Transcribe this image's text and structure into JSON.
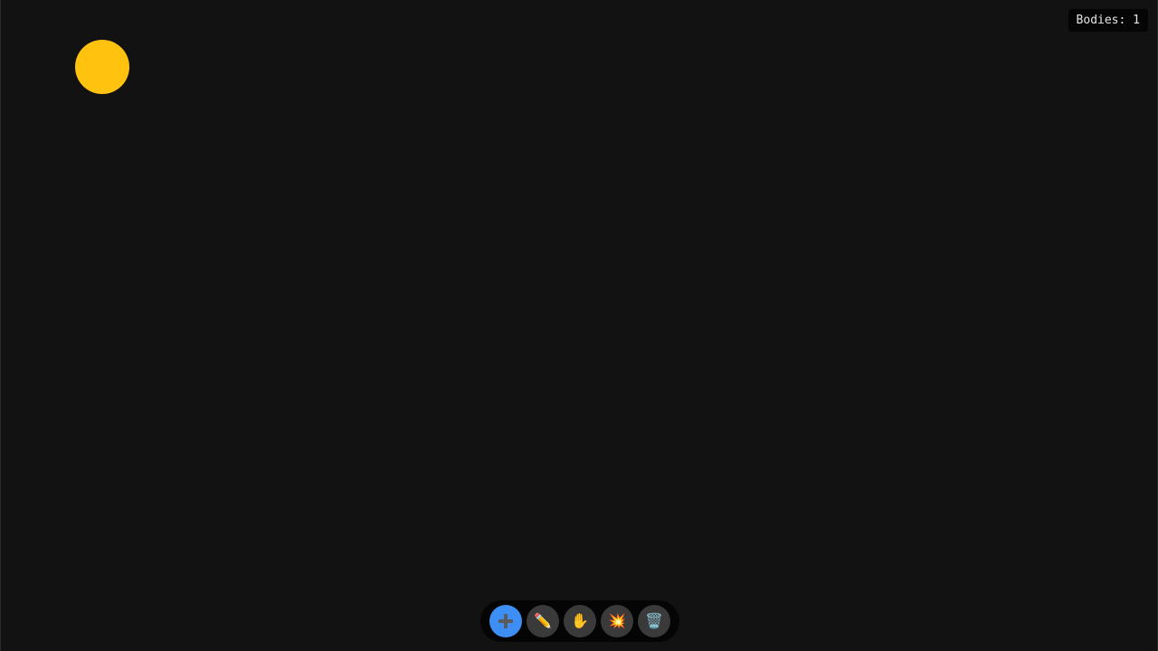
{
  "canvas": {
    "background": "#121212"
  },
  "bodies": [
    {
      "shape": "circle",
      "color": "#ffc20f"
    }
  ],
  "status": {
    "bodies_label": "Bodies: 1"
  },
  "toolbar": {
    "active_tool": "add",
    "active_color": "#3d8ef5",
    "tools": [
      {
        "name": "add",
        "icon": "plus-icon"
      },
      {
        "name": "draw",
        "icon": "pencil-icon"
      },
      {
        "name": "grab",
        "icon": "hand-icon"
      },
      {
        "name": "explode",
        "icon": "explosion-icon"
      },
      {
        "name": "clear",
        "icon": "trash-icon"
      }
    ]
  }
}
